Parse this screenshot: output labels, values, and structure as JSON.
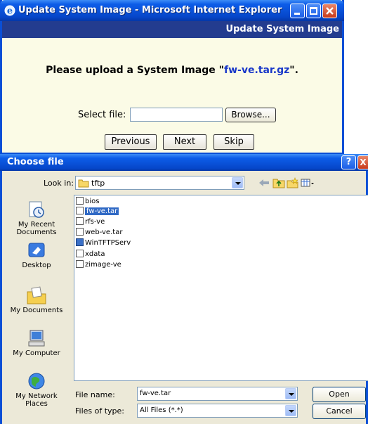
{
  "ie_window": {
    "title": "Update System Image - Microsoft Internet Explorer",
    "header": "Update System Image",
    "message_prefix": "Please upload a System Image \"",
    "message_filename": "fw-ve.tar.gz",
    "message_suffix": "\".",
    "select_label": "Select file:",
    "file_value": "",
    "browse_label": "Browse...",
    "previous_label": "Previous",
    "next_label": "Next",
    "skip_label": "Skip"
  },
  "dialog": {
    "title": "Choose file",
    "help_glyph": "?",
    "close_glyph": "X",
    "look_in_label": "Look in:",
    "look_in_value": "tftp",
    "places": [
      {
        "label": "My Recent Documents",
        "icon": "recent-documents-icon"
      },
      {
        "label": "Desktop",
        "icon": "desktop-icon"
      },
      {
        "label": "My Documents",
        "icon": "my-documents-icon"
      },
      {
        "label": "My Computer",
        "icon": "my-computer-icon"
      },
      {
        "label": "My Network Places",
        "icon": "network-places-icon"
      }
    ],
    "files": [
      {
        "name": "bios",
        "icon": "file-icon",
        "selected": false
      },
      {
        "name": "fw-ve.tar",
        "icon": "file-icon",
        "selected": true
      },
      {
        "name": "rfs-ve",
        "icon": "file-icon",
        "selected": false
      },
      {
        "name": "web-ve.tar",
        "icon": "file-icon",
        "selected": false
      },
      {
        "name": "WinTFTPServ",
        "icon": "application-icon",
        "selected": false
      },
      {
        "name": "xdata",
        "icon": "file-icon",
        "selected": false
      },
      {
        "name": "zimage-ve",
        "icon": "file-icon",
        "selected": false
      }
    ],
    "file_name_label": "File name:",
    "file_name_value": "fw-ve.tar",
    "file_type_label": "Files of type:",
    "file_type_value": "All Files (*.*)",
    "open_label": "Open",
    "cancel_label": "Cancel"
  }
}
